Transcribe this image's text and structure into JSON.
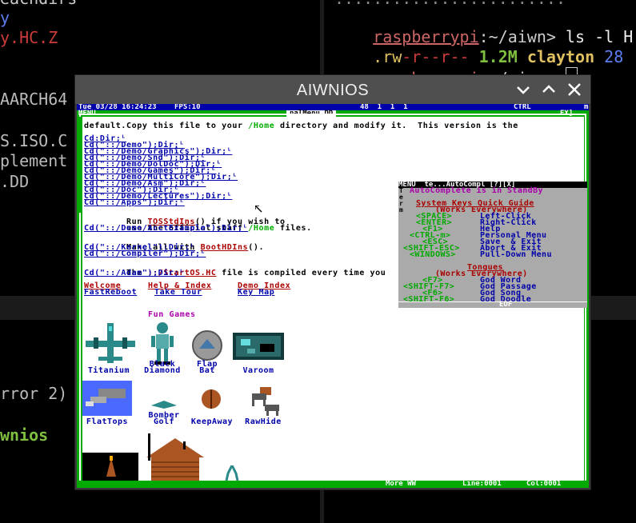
{
  "bg_terminal_left": {
    "lines": [
      "eachdirs",
      "y",
      "y.HC.Z",
      "",
      "AARCH64",
      "",
      "S.ISO.C",
      "plement",
      ".DD"
    ],
    "bottom_lines": [
      "rror 2)",
      "",
      "wnios"
    ]
  },
  "bg_terminal_right": {
    "line1_prompt": "raspberrypi",
    "line1_path": ":~/aiwn>",
    "line1_cmd": " ls -l H",
    "line2_perms_a": ".rw",
    "line2_perms_b": "-r--r--",
    "line2_size": " 1.2M",
    "line2_user": " clayton",
    "line2_date": " 28",
    "line3_prompt": "raspberrypi",
    "line3_path": ":~/aiwn>"
  },
  "window": {
    "title": "AIWNIOS",
    "minimize_icon": "chevron-down",
    "maximize_icon": "chevron-up",
    "close_icon": "close"
  },
  "topbar": {
    "datetime": "Tue 03/28 16:24:23",
    "fps": "FPS:10",
    "counters": "48  1  1  1",
    "ctrl": "CTRL",
    "menu": "MENU",
    "doc_title": "nalMenu.DD",
    "ext": "EX]"
  },
  "doc": {
    "intro_1": "Copy this file to your ",
    "intro_home": "/Home",
    "intro_2": " directory and modify it.  This version is the",
    "intro_3": "default.",
    "cd_links": [
      "Cd:Dir;ᴸ",
      "Cd(\"::/Demo\");Dir;ᴸ",
      "Cd(\"::/Demo/Graphics\");Dir;ᴸ",
      "Cd(\"::/Demo/Snd\");Dir;ᴸ",
      "Cd(\"::/Demo/DolDoc\");Dir;ᴸ",
      "Cd(\"::/Demo/Games\");Dir;ᴸ",
      "Cd(\"::/Demo/MultiCore\");Dir;ᴸ",
      "Cd(\"::/Demo/Asm\");Dir;ᴸ",
      "Cd(\"::/Doc\");Dir;ᴸ",
      "Cd(\"::/Demo/Lectures\");Dir;ᴸ",
      "Cd(\"::/Apps\");Dir;ᴸ"
    ],
    "run_1": "Run ",
    "run_link": "TOSStdIns",
    "run_2": "() if you wish to",
    "use_1": "use the official staff ",
    "use_home": "/Home",
    "use_2": " files.",
    "acct_link": "Cd(\"::/Demo/AcctExample\");Dir;ᴸ",
    "make_1": "Make all with ",
    "make_link": "BootHDIns",
    "make_2": "().",
    "kernel_link": "Cd(\"::/Kernel\");Dir;ᴸ",
    "compiler_link": "Cd(\"::/Compiler\");Dir;ᴸ",
    "the_1": "The ",
    "the_link": "::/StartOS.HC",
    "the_2": " file is compiled every time you",
    "adam_link": "Cd(\"::/Adam\");Dir;ᴸ",
    "welcome": "Welcome",
    "help_index": "Help & Index",
    "demo_index": "Demo Index",
    "fast_reboot": "FastReboot",
    "take_tour": "Take Tour",
    "key_map": "Key Map",
    "fun_games": "Fun Games",
    "games": [
      {
        "line1": "Titanium",
        "line2": ""
      },
      {
        "line1": "Black",
        "line2": "Diamond"
      },
      {
        "line1": "Flap",
        "line2": "Bat"
      },
      {
        "line1": "Varoom",
        "line2": ""
      },
      {
        "line1": "FlatTops",
        "line2": ""
      },
      {
        "line1": "Bomber",
        "line2": "Golf"
      },
      {
        "line1": "KeepAway",
        "line2": ""
      },
      {
        "line1": "RawHide",
        "line2": ""
      }
    ]
  },
  "autocomplete": {
    "header": "MENU  te...AutoCompl [?][X]",
    "status": "AutoComplete is in StandBy",
    "side_letters": [
      "T",
      "e",
      "r",
      "m"
    ],
    "quick_guide_title": "System Keys Quick Guide",
    "works_everywhere": "(Works Everywhere)",
    "keys": [
      {
        "key": "<SPACE>",
        "action": "Left-Click"
      },
      {
        "key": "<ENTER>",
        "action": "Right-Click"
      },
      {
        "key": "<F1>",
        "action": "Help"
      },
      {
        "key": "<CTRL-m>",
        "action": "Personal Menu"
      },
      {
        "key": "<ESC>",
        "action": "Save  & Exit"
      },
      {
        "key": "<SHIFT-ESC>",
        "action": "Abort & Exit"
      },
      {
        "key": "<WINDOWS>",
        "action": "Pull-Down Menu"
      }
    ],
    "tongues_title": "Tongues",
    "tongues_works": "(Works Everywhere)",
    "tongue_keys": [
      {
        "key": "<F7>",
        "action": "God Word"
      },
      {
        "key": "<SHIFT-F7>",
        "action": "God Passage"
      },
      {
        "key": "<F6>",
        "action": "God Song"
      },
      {
        "key": "<SHIFT-F6>",
        "action": "God Doodle"
      }
    ],
    "eof": "EOF"
  },
  "statusbar": {
    "mode": "More WW",
    "line": "Line:0001",
    "col": "Col:0001"
  },
  "colors": {
    "tos_green": "#00aa00",
    "tos_blue": "#0000aa",
    "tos_red": "#aa0000",
    "tos_magenta": "#aa00aa",
    "terminal_red": "#cc3b3b",
    "terminal_green": "#7fbf3f",
    "terminal_yellow": "#e0c060"
  }
}
